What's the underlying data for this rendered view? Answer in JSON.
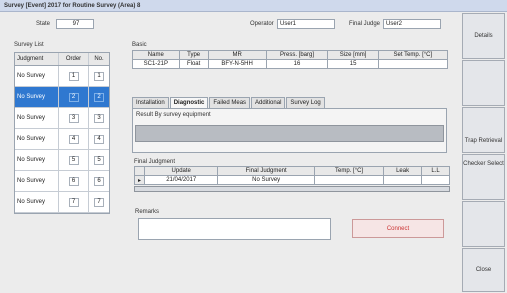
{
  "window": {
    "title": "Survey [Event] 2017 for Routine Survey (Area) 8"
  },
  "header": {
    "state_label": "State",
    "state_value": "97",
    "operator_label": "Operator",
    "operator_value": "User1",
    "final_judge_label": "Final Judge",
    "final_judge_value": "User2"
  },
  "survey_list": {
    "label": "Survey List",
    "columns": [
      "Judgment",
      "Order",
      "No."
    ],
    "rows": [
      {
        "judgment": "No Survey",
        "order": "1",
        "no": "1",
        "selected": false
      },
      {
        "judgment": "No Survey",
        "order": "2",
        "no": "2",
        "selected": true
      },
      {
        "judgment": "No Survey",
        "order": "3",
        "no": "3",
        "selected": false
      },
      {
        "judgment": "No Survey",
        "order": "4",
        "no": "4",
        "selected": false
      },
      {
        "judgment": "No Survey",
        "order": "5",
        "no": "5",
        "selected": false
      },
      {
        "judgment": "No Survey",
        "order": "6",
        "no": "6",
        "selected": false
      },
      {
        "judgment": "No Survey",
        "order": "7",
        "no": "7",
        "selected": false
      }
    ]
  },
  "basic": {
    "label": "Basic",
    "columns": [
      "Name",
      "Type",
      "MR",
      "Press. [barg]",
      "Size [mm]",
      "Set Temp. [°C]"
    ],
    "row": [
      "SC1-21P",
      "Float",
      "BFY-N-5HH",
      "16",
      "15",
      ""
    ]
  },
  "tabs": [
    "Installation",
    "Diagnostic",
    "Failed Meas",
    "Additional",
    "Survey Log"
  ],
  "active_tab": 1,
  "result": {
    "label": "Result By survey equipment"
  },
  "final_judgment": {
    "label": "Final Judgment",
    "columns": [
      "Update",
      "Final Judgment",
      "Temp. [°C]",
      "Leak",
      "L.L"
    ],
    "rows": [
      {
        "marker": "▸",
        "update": "21/04/2017",
        "judgment": "No Survey",
        "temp": "",
        "leak": "",
        "ll": ""
      }
    ]
  },
  "remarks": {
    "label": "Remarks",
    "value": ""
  },
  "buttons": {
    "connect": "Connect",
    "details": "Details",
    "trap_retrieval": "Trap Retrieval",
    "checker_select": "Checker Select",
    "close": "Close"
  },
  "colors": {
    "selection": "#2f78d0",
    "connect_text": "#cc3333"
  }
}
